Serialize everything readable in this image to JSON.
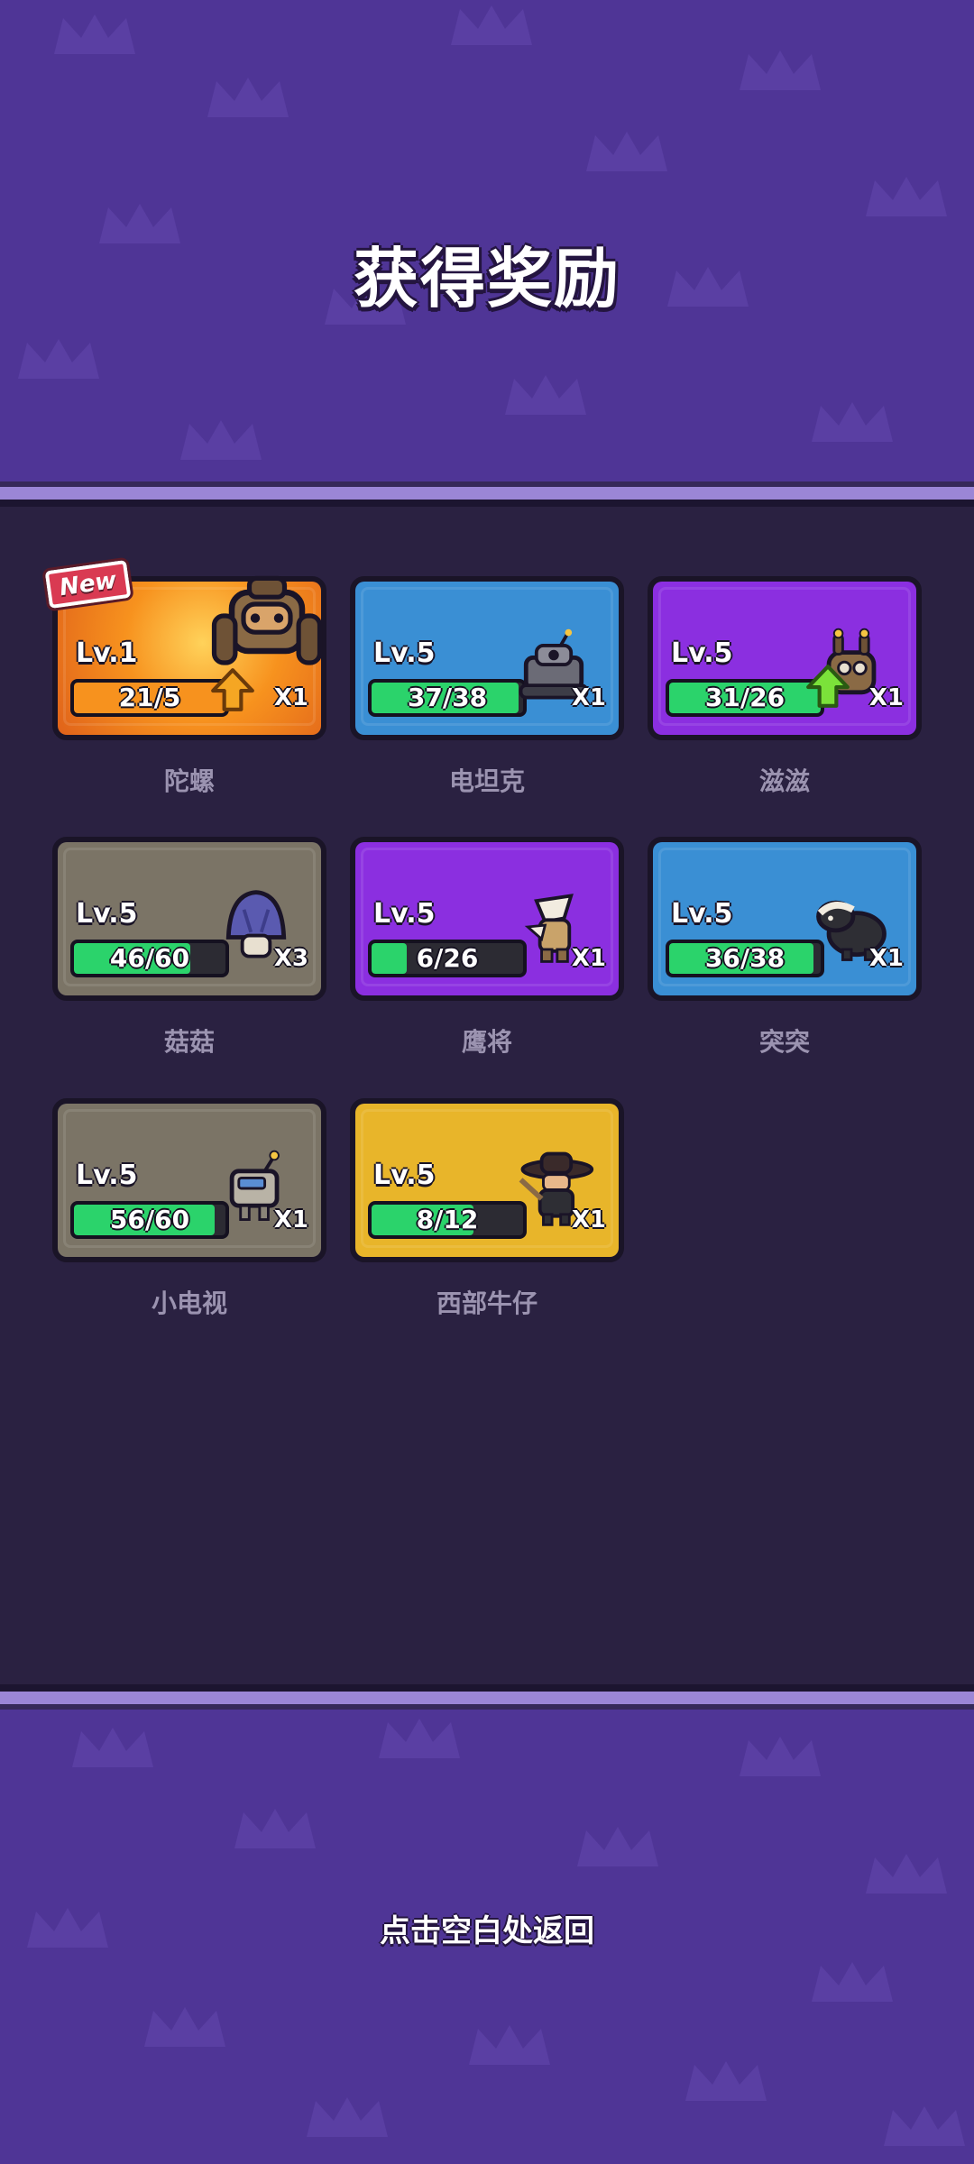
{
  "title": "获得奖励",
  "footer": "点击空白处返回",
  "colors": {
    "background": "#4f3596",
    "panel": "#2a2141",
    "panel_border": "#9b86d6",
    "bar_green": "#2bd36b",
    "bar_orange": "#f7921e"
  },
  "rewards": [
    {
      "name": "陀螺",
      "level": "Lv.1",
      "progress_text": "21/5",
      "progress": 1.0,
      "quantity": "X1",
      "card_color": "#f08a24",
      "bar_color": "orange",
      "new_label": "New",
      "upgradable": true,
      "icon": "gyro-robot-icon"
    },
    {
      "name": "电坦克",
      "level": "Lv.5",
      "progress_text": "37/38",
      "progress": 0.97,
      "quantity": "X1",
      "card_color": "#3a8fd4",
      "bar_color": "green",
      "upgradable": false,
      "icon": "tank-robot-icon"
    },
    {
      "name": "滋滋",
      "level": "Lv.5",
      "progress_text": "31/26",
      "progress": 1.0,
      "quantity": "X1",
      "card_color": "#8b2fe0",
      "bar_color": "green",
      "upgradable": true,
      "icon": "buzz-robot-icon"
    },
    {
      "name": "菇菇",
      "level": "Lv.5",
      "progress_text": "46/60",
      "progress": 0.77,
      "quantity": "X3",
      "card_color": "#7b7466",
      "bar_color": "green",
      "upgradable": false,
      "icon": "mushroom-icon"
    },
    {
      "name": "鹰将",
      "level": "Lv.5",
      "progress_text": "6/26",
      "progress": 0.23,
      "quantity": "X1",
      "card_color": "#8b2fe0",
      "bar_color": "green",
      "upgradable": false,
      "icon": "eagle-general-icon"
    },
    {
      "name": "突突",
      "level": "Lv.5",
      "progress_text": "36/38",
      "progress": 0.95,
      "quantity": "X1",
      "card_color": "#3a8fd4",
      "bar_color": "green",
      "upgradable": false,
      "icon": "badger-icon"
    },
    {
      "name": "小电视",
      "level": "Lv.5",
      "progress_text": "56/60",
      "progress": 0.93,
      "quantity": "X1",
      "card_color": "#7b7466",
      "bar_color": "green",
      "upgradable": false,
      "icon": "tv-robot-icon"
    },
    {
      "name": "西部牛仔",
      "level": "Lv.5",
      "progress_text": "8/12",
      "progress": 0.67,
      "quantity": "X1",
      "card_color": "#e8b52a",
      "bar_color": "green",
      "upgradable": false,
      "icon": "cowboy-icon"
    }
  ]
}
